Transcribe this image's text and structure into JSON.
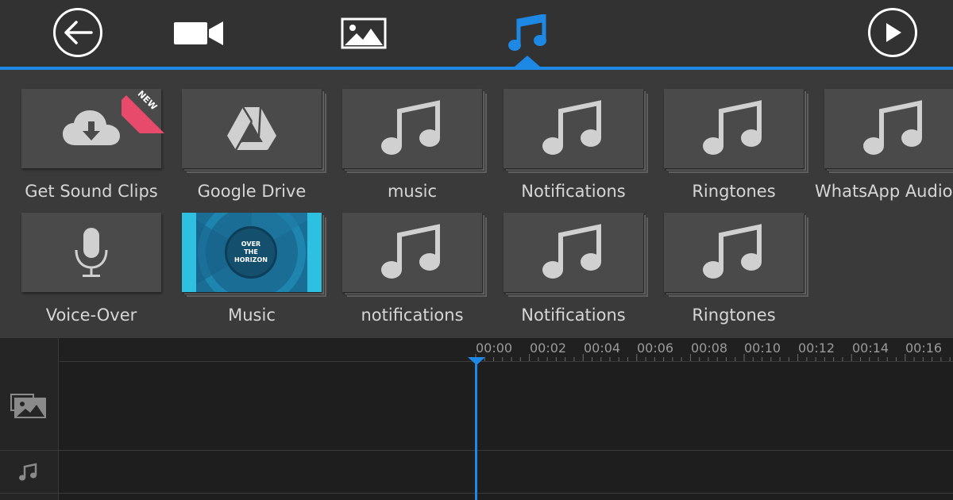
{
  "toolbar": {
    "back": "back-arrow-icon",
    "tabs": [
      {
        "id": "video",
        "icon": "video-camera-icon",
        "active": false
      },
      {
        "id": "photo",
        "icon": "image-icon",
        "active": false
      },
      {
        "id": "audio",
        "icon": "music-note-icon",
        "active": true
      }
    ],
    "play": "play-icon",
    "accent_color": "#1e88e5"
  },
  "library": {
    "items": [
      {
        "label": "Get Sound Clips",
        "icon": "cloud-download-icon",
        "badge": "NEW"
      },
      {
        "label": "Google Drive",
        "icon": "google-drive-icon"
      },
      {
        "label": "music",
        "icon": "music-note-icon"
      },
      {
        "label": "Notifications",
        "icon": "music-note-icon"
      },
      {
        "label": "Ringtones",
        "icon": "music-note-icon"
      },
      {
        "label": "WhatsApp Audio",
        "icon": "music-note-icon"
      },
      {
        "label": "Voice-Over",
        "icon": "microphone-icon"
      },
      {
        "label": "Music",
        "album_text": [
          "OVER",
          "THE",
          "HORIZON"
        ]
      },
      {
        "label": "notifications",
        "icon": "music-note-icon"
      },
      {
        "label": "Notifications",
        "icon": "music-note-icon"
      },
      {
        "label": "Ringtones",
        "icon": "music-note-icon"
      }
    ]
  },
  "timeline": {
    "times": [
      "00:00",
      "00:02",
      "00:04",
      "00:06",
      "00:08",
      "00:10",
      "00:12",
      "00:14",
      "00:16"
    ],
    "tracks": [
      {
        "id": "video",
        "icon": "photo-video-track-icon"
      },
      {
        "id": "audio",
        "icon": "music-track-icon"
      }
    ],
    "playhead": "00:00"
  }
}
